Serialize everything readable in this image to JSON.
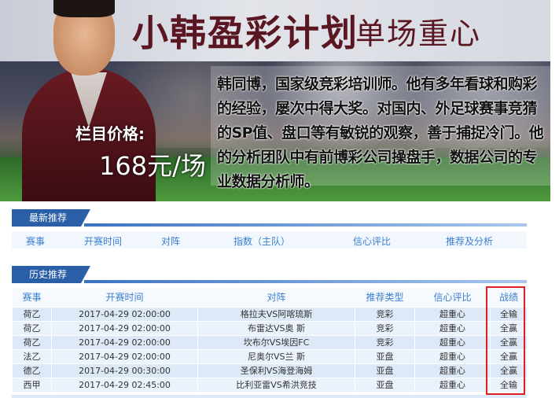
{
  "banner": {
    "title": "小韩盈彩计划",
    "subtitle": "单场重心",
    "price_label": "栏目价格:",
    "price_value": "168元/场",
    "intro": "韩同博，国家级竞彩培训师。他有多年看球和购彩的经验，屡次中得大奖。对国内、外足球赛事竞猜的SP值、盘口等有敏锐的观察，善于捕捉冷门。他的分析团队中有前博彩公司操盘手，数据公司的专业数据分析师。"
  },
  "latest": {
    "label": "最新推荐",
    "columns": [
      "赛事",
      "开赛时间",
      "对阵",
      "指数（主队）",
      "信心评比",
      "推荐及分析"
    ]
  },
  "history": {
    "label": "历史推荐",
    "columns": [
      "赛事",
      "开赛时间",
      "对阵",
      "推荐类型",
      "信心评比",
      "战绩"
    ],
    "rows": [
      {
        "league": "荷乙",
        "time": "2017-04-29 02:00:00",
        "match": "格拉夫VS阿喀琉斯",
        "type": "竞彩",
        "confidence": "超重心",
        "result": "全输"
      },
      {
        "league": "荷乙",
        "time": "2017-04-29 02:00:00",
        "match": "布雷达VS奥 斯",
        "type": "竞彩",
        "confidence": "超重心",
        "result": "全赢"
      },
      {
        "league": "荷乙",
        "time": "2017-04-29 02:00:00",
        "match": "坎布尔VS埃因FC",
        "type": "竞彩",
        "confidence": "超重心",
        "result": "全赢"
      },
      {
        "league": "法乙",
        "time": "2017-04-29 02:00:00",
        "match": "尼奥尔VS兰 斯",
        "type": "亚盘",
        "confidence": "超重心",
        "result": "全赢"
      },
      {
        "league": "德乙",
        "time": "2017-04-29 00:30:00",
        "match": "圣保利VS海登海姆",
        "type": "亚盘",
        "confidence": "超重心",
        "result": "全赢"
      },
      {
        "league": "西甲",
        "time": "2017-04-29 02:45:00",
        "match": "比利亚雷VS希洪竞技",
        "type": "亚盘",
        "confidence": "超重心",
        "result": "全输"
      }
    ]
  },
  "colors": {
    "accent": "#2a5fa8",
    "header_text": "#3a7fd0",
    "title": "#5a1621",
    "highlight": "#e02020"
  }
}
